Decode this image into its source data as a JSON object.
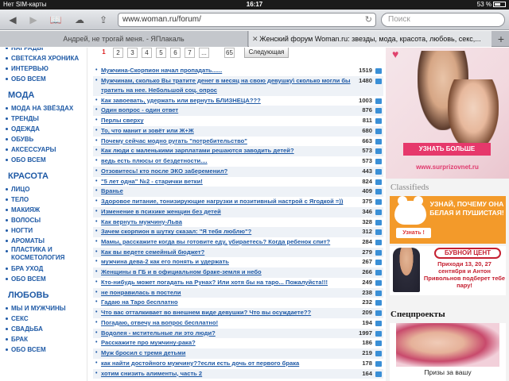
{
  "status": {
    "carrier": "Нет SIM-карты",
    "time": "16:17",
    "battery": "53 %"
  },
  "toolbar": {
    "url": "www.woman.ru/forum/",
    "search_placeholder": "Поиск"
  },
  "tabs": [
    {
      "label": "Андрей, не трогай меня. - ЯПлакаль"
    },
    {
      "label": "Женский форум Woman.ru: звезды, мода, красота, любовь, секс,..."
    }
  ],
  "sidebar": {
    "top_items": [
      "НАГРАДЫ",
      "СВЕТСКАЯ ХРОНИКА",
      "ИНТЕРВЬЮ",
      "ОБО ВСЕМ"
    ],
    "sections": [
      {
        "title": "МОДА",
        "items": [
          "МОДА НА ЗВЁЗДАХ",
          "ТРЕНДЫ",
          "ОДЕЖДА",
          "ОБУВЬ",
          "АКСЕССУАРЫ",
          "ОБО ВСЕМ"
        ]
      },
      {
        "title": "КРАСОТА",
        "items": [
          "ЛИЦО",
          "ТЕЛО",
          "МАКИЯЖ",
          "ВОЛОСЫ",
          "НОГТИ",
          "АРОМАТЫ",
          "ПЛАСТИКА И КОСМЕТОЛОГИЯ",
          "БРА УХОД",
          "ОБО ВСЕМ"
        ]
      },
      {
        "title": "ЛЮБОВЬ",
        "items": [
          "МЫ И МУЖЧИНЫ",
          "СЕКС",
          "СВАДЬБА",
          "БРАК",
          "ОБО ВСЕМ"
        ]
      }
    ]
  },
  "pager": {
    "pages": [
      "1",
      "2",
      "3",
      "4",
      "5",
      "6",
      "7",
      "...",
      "65"
    ],
    "next_label": "Следующая"
  },
  "topics": [
    {
      "title": "Мужчина-Скорпион начал пропадать......",
      "count": "1519"
    },
    {
      "title": "Мужчинам, сколько Вы тратите денег в месяц на свою девушку\\ сколько могли бы тратить на нее. Небольшой соц. опрос",
      "count": "1480",
      "wrap": true
    },
    {
      "title": "Как завоевать, удержать или вернуть БЛИЗНЕЦА???",
      "count": "1003"
    },
    {
      "title": "Один вопрос - один ответ",
      "count": "876"
    },
    {
      "title": "Перлы сверху",
      "count": "811"
    },
    {
      "title": "То, что манит и зовёт или Ж+Ж",
      "count": "680"
    },
    {
      "title": "Почему сейчас модно ругать \"потребительство\"",
      "count": "663"
    },
    {
      "title": "Как люди с маленькими зарплатами решаются заводить детей?",
      "count": "573"
    },
    {
      "title": "ведь есть плюсы от бездетности....",
      "count": "573"
    },
    {
      "title": "Отзовитесь! кто после ЭКО забеременил?",
      "count": "443"
    },
    {
      "title": "\"5 лет одна\" №2 - старички ветки!",
      "count": "824"
    },
    {
      "title": "Вранье",
      "count": "409"
    },
    {
      "title": "Здоровое питание, тонизирующие нагрузки и позитивный настрой с Ягодкой =))",
      "count": "375"
    },
    {
      "title": "Изменение в психике женщин без детей",
      "count": "346"
    },
    {
      "title": "Как вернуть мужчину-Льва",
      "count": "328"
    },
    {
      "title": "Зачем скорпион в шутку сказал: \"Я тебя люблю\"?",
      "count": "312"
    },
    {
      "title": "Мамы, расскажите когда вы готовите еду, убираетесь? Когда ребенок спит?",
      "count": "284"
    },
    {
      "title": "Как вы ведете семейный бюджет?",
      "count": "279"
    },
    {
      "title": "мужчина дева-2 как его понять и удержать",
      "count": "267"
    },
    {
      "title": "Женщины в ГБ и в официальном браке-земля и небо",
      "count": "266"
    },
    {
      "title": "Кто-нибудь может погадать на Рунах? Или хотя бы на таро... Пожалуйста!!!",
      "count": "249"
    },
    {
      "title": "не понравилась в постели",
      "count": "238"
    },
    {
      "title": "Гадаю на Таро бесплатно",
      "count": "232"
    },
    {
      "title": "Что вас отталкивает во внешнем виде девушки? Что вы осуждаете??",
      "count": "209"
    },
    {
      "title": "Погадаю, отвечу на вопрос бесплатно!",
      "count": "194"
    },
    {
      "title": "Водолея - мстительные ли это люди?",
      "count": "1997"
    },
    {
      "title": "Расскажите про мужчину-рака?",
      "count": "186"
    },
    {
      "title": "Муж бросил с тремя детьми",
      "count": "219"
    },
    {
      "title": "как найти достойного мужчину??если есть дочь от первого брака",
      "count": "178"
    },
    {
      "title": "хотим снизить алименты, часть 2",
      "count": "164"
    }
  ],
  "right": {
    "ad1_button": "УЗНАТЬ БОЛЬШЕ",
    "ad1_site": "www.surprizovnet.ru",
    "classifieds": "Classifieds",
    "ad2_text": "УЗНАЙ, ПОЧЕМУ ОНА БЕЛАЯ И ПУШИСТАЯ!",
    "ad2_button": "Узнать !",
    "ad3_logo": "БУВНОЙ ЦЕНТ",
    "ad3_text": "Приходи 13, 20, 27 сентября и Антон Привольнов подберет тебе пару!",
    "specprojects": "Спецпроекты",
    "ad4_caption": "Призы за вашу"
  },
  "colors": {
    "link": "#1f5aa6",
    "accent": "#e6386b",
    "orange": "#f39a2a"
  }
}
